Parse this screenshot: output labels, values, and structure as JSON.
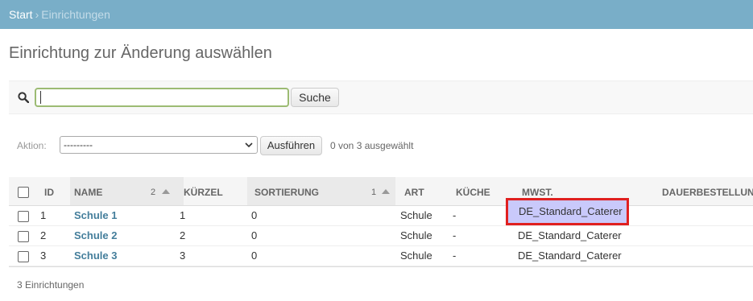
{
  "breadcrumbs": {
    "home": "Start",
    "separator": "›",
    "current": "Einrichtungen"
  },
  "page_title": "Einrichtung zur Änderung auswählen",
  "search": {
    "value": "",
    "button_label": "Suche"
  },
  "actions": {
    "label": "Aktion:",
    "selected": "---------",
    "run_label": "Ausführen",
    "counter": "0 von 3 ausgewählt"
  },
  "table": {
    "columns": {
      "id": "ID",
      "name": "NAME",
      "name_sort_priority": "2",
      "kuerzel": "KÜRZEL",
      "sortierung": "SORTIERUNG",
      "sortierung_sort_priority": "1",
      "art": "ART",
      "kueche": "KÜCHE",
      "mwst": "MWST.",
      "dauer": "DAUERBESTELLUNG"
    },
    "rows": [
      {
        "id": "1",
        "name": "Schule 1",
        "kuerzel": "1",
        "sortierung": "0",
        "art": "Schule",
        "kueche": "-",
        "mwst": "DE_Standard_Caterer"
      },
      {
        "id": "2",
        "name": "Schule 2",
        "kuerzel": "2",
        "sortierung": "0",
        "art": "Schule",
        "kueche": "-",
        "mwst": "DE_Standard_Caterer"
      },
      {
        "id": "3",
        "name": "Schule 3",
        "kuerzel": "3",
        "sortierung": "0",
        "art": "Schule",
        "kueche": "-",
        "mwst": "DE_Standard_Caterer"
      }
    ]
  },
  "footer": {
    "count_text": "3 Einrichtungen"
  },
  "colors": {
    "header_bar": "#79aec8",
    "link": "#447e9b",
    "highlight_fill": "#c9c9fb",
    "highlight_border": "#e02020",
    "search_focus": "#9cbb73"
  }
}
